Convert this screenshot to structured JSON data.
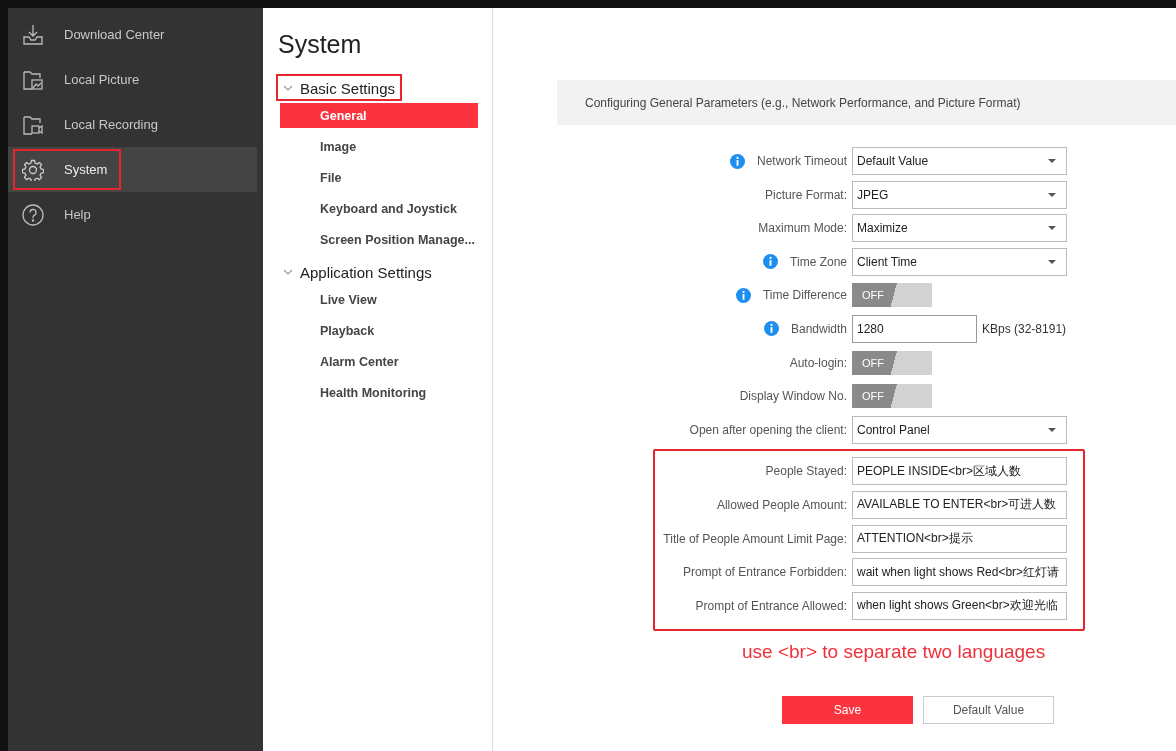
{
  "sidebar": {
    "items": [
      {
        "label": "Download Center",
        "selected": false,
        "highlighted": false
      },
      {
        "label": "Local Picture",
        "selected": false,
        "highlighted": false
      },
      {
        "label": "Local Recording",
        "selected": false,
        "highlighted": false
      },
      {
        "label": "System",
        "selected": true,
        "highlighted": true
      },
      {
        "label": "Help",
        "selected": false,
        "highlighted": false
      }
    ]
  },
  "page_title": "System",
  "nav": {
    "groups": [
      {
        "label": "Basic Settings",
        "expanded": true,
        "highlighted": true,
        "items": [
          {
            "label": "General",
            "selected": true
          },
          {
            "label": "Image",
            "selected": false
          },
          {
            "label": "File",
            "selected": false
          },
          {
            "label": "Keyboard and Joystick",
            "selected": false
          },
          {
            "label": "Screen Position Manage...",
            "selected": false
          }
        ]
      },
      {
        "label": "Application Settings",
        "expanded": true,
        "highlighted": false,
        "items": [
          {
            "label": "Live View",
            "selected": false
          },
          {
            "label": "Playback",
            "selected": false
          },
          {
            "label": "Alarm Center",
            "selected": false
          },
          {
            "label": "Health Monitoring",
            "selected": false
          }
        ]
      }
    ]
  },
  "panel": {
    "header": "Configuring General Parameters (e.g., Network Performance, and Picture Format)",
    "sections": [
      {
        "highlighted": false,
        "rows": [
          {
            "kind": "select",
            "label": "Network Timeout",
            "info": true,
            "value": "Default Value"
          },
          {
            "kind": "select",
            "label": "Picture Format:",
            "info": false,
            "value": "JPEG"
          },
          {
            "kind": "select",
            "label": "Maximum Mode:",
            "info": false,
            "value": "Maximize"
          },
          {
            "kind": "select",
            "label": "Time Zone",
            "info": true,
            "value": "Client Time"
          },
          {
            "kind": "toggle",
            "label": "Time Difference",
            "info": true,
            "on": false,
            "value": "OFF"
          },
          {
            "kind": "text",
            "label": "Bandwidth",
            "info": true,
            "value": "1280",
            "unit": "KBps (32-8191)"
          },
          {
            "kind": "toggle",
            "label": "Auto-login:",
            "info": false,
            "on": false,
            "value": "OFF"
          },
          {
            "kind": "toggle",
            "label": "Display Window No.",
            "info": false,
            "on": false,
            "value": "OFF"
          },
          {
            "kind": "select",
            "label": "Open after opening the client:",
            "info": false,
            "value": "Control Panel"
          }
        ]
      },
      {
        "highlighted": true,
        "rows": [
          {
            "kind": "text",
            "label": "People Stayed:",
            "info": false,
            "value": "PEOPLE INSIDE<br>区域人数"
          },
          {
            "kind": "text",
            "label": "Allowed People Amount:",
            "info": false,
            "value": "AVAILABLE TO ENTER<br>可进人数"
          },
          {
            "kind": "text",
            "label": "Title of People Amount Limit Page:",
            "info": false,
            "value": "ATTENTION<br>提示"
          },
          {
            "kind": "text",
            "label": "Prompt of Entrance Forbidden:",
            "info": false,
            "value": "wait when light shows Red<br>红灯请"
          },
          {
            "kind": "text",
            "label": "Prompt of Entrance Allowed:",
            "info": false,
            "value": "when light shows Green<br>欢迎光临"
          }
        ]
      }
    ],
    "note": "use <br> to separate two languages",
    "buttons": [
      {
        "label": "Save",
        "kind": "primary"
      },
      {
        "label": "Default Value",
        "kind": "secondary"
      }
    ]
  }
}
